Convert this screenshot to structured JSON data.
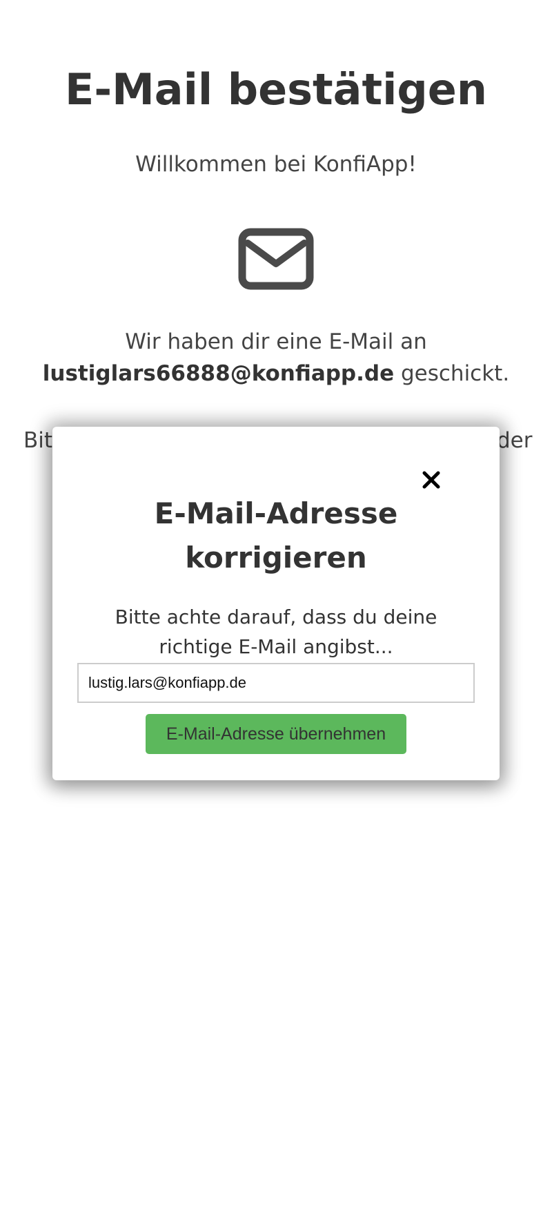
{
  "page": {
    "title": "E-Mail bestätigen",
    "welcome": "Willkommen bei KonfiApp!",
    "envelope_icon": "envelope-icon",
    "sent_prefix": "Wir haben dir eine E-Mail an",
    "sent_email": "lustiglars66888@konfiapp.de",
    "sent_suffix": " geschickt.",
    "hint_visible_start": "Bit",
    "hint_visible_end": "der"
  },
  "modal": {
    "close_icon": "close-icon",
    "title_line1": "E-Mail-Adresse",
    "title_line2": "korrigieren",
    "text": "Bitte achte darauf, dass du deine richtige E-Mail angibst...",
    "input_value": "lustig.lars@konfiapp.de",
    "submit_label": "E-Mail-Adresse übernehmen"
  },
  "colors": {
    "text": "#333333",
    "button_bg": "#5cb85c",
    "input_border": "#cccccc"
  }
}
